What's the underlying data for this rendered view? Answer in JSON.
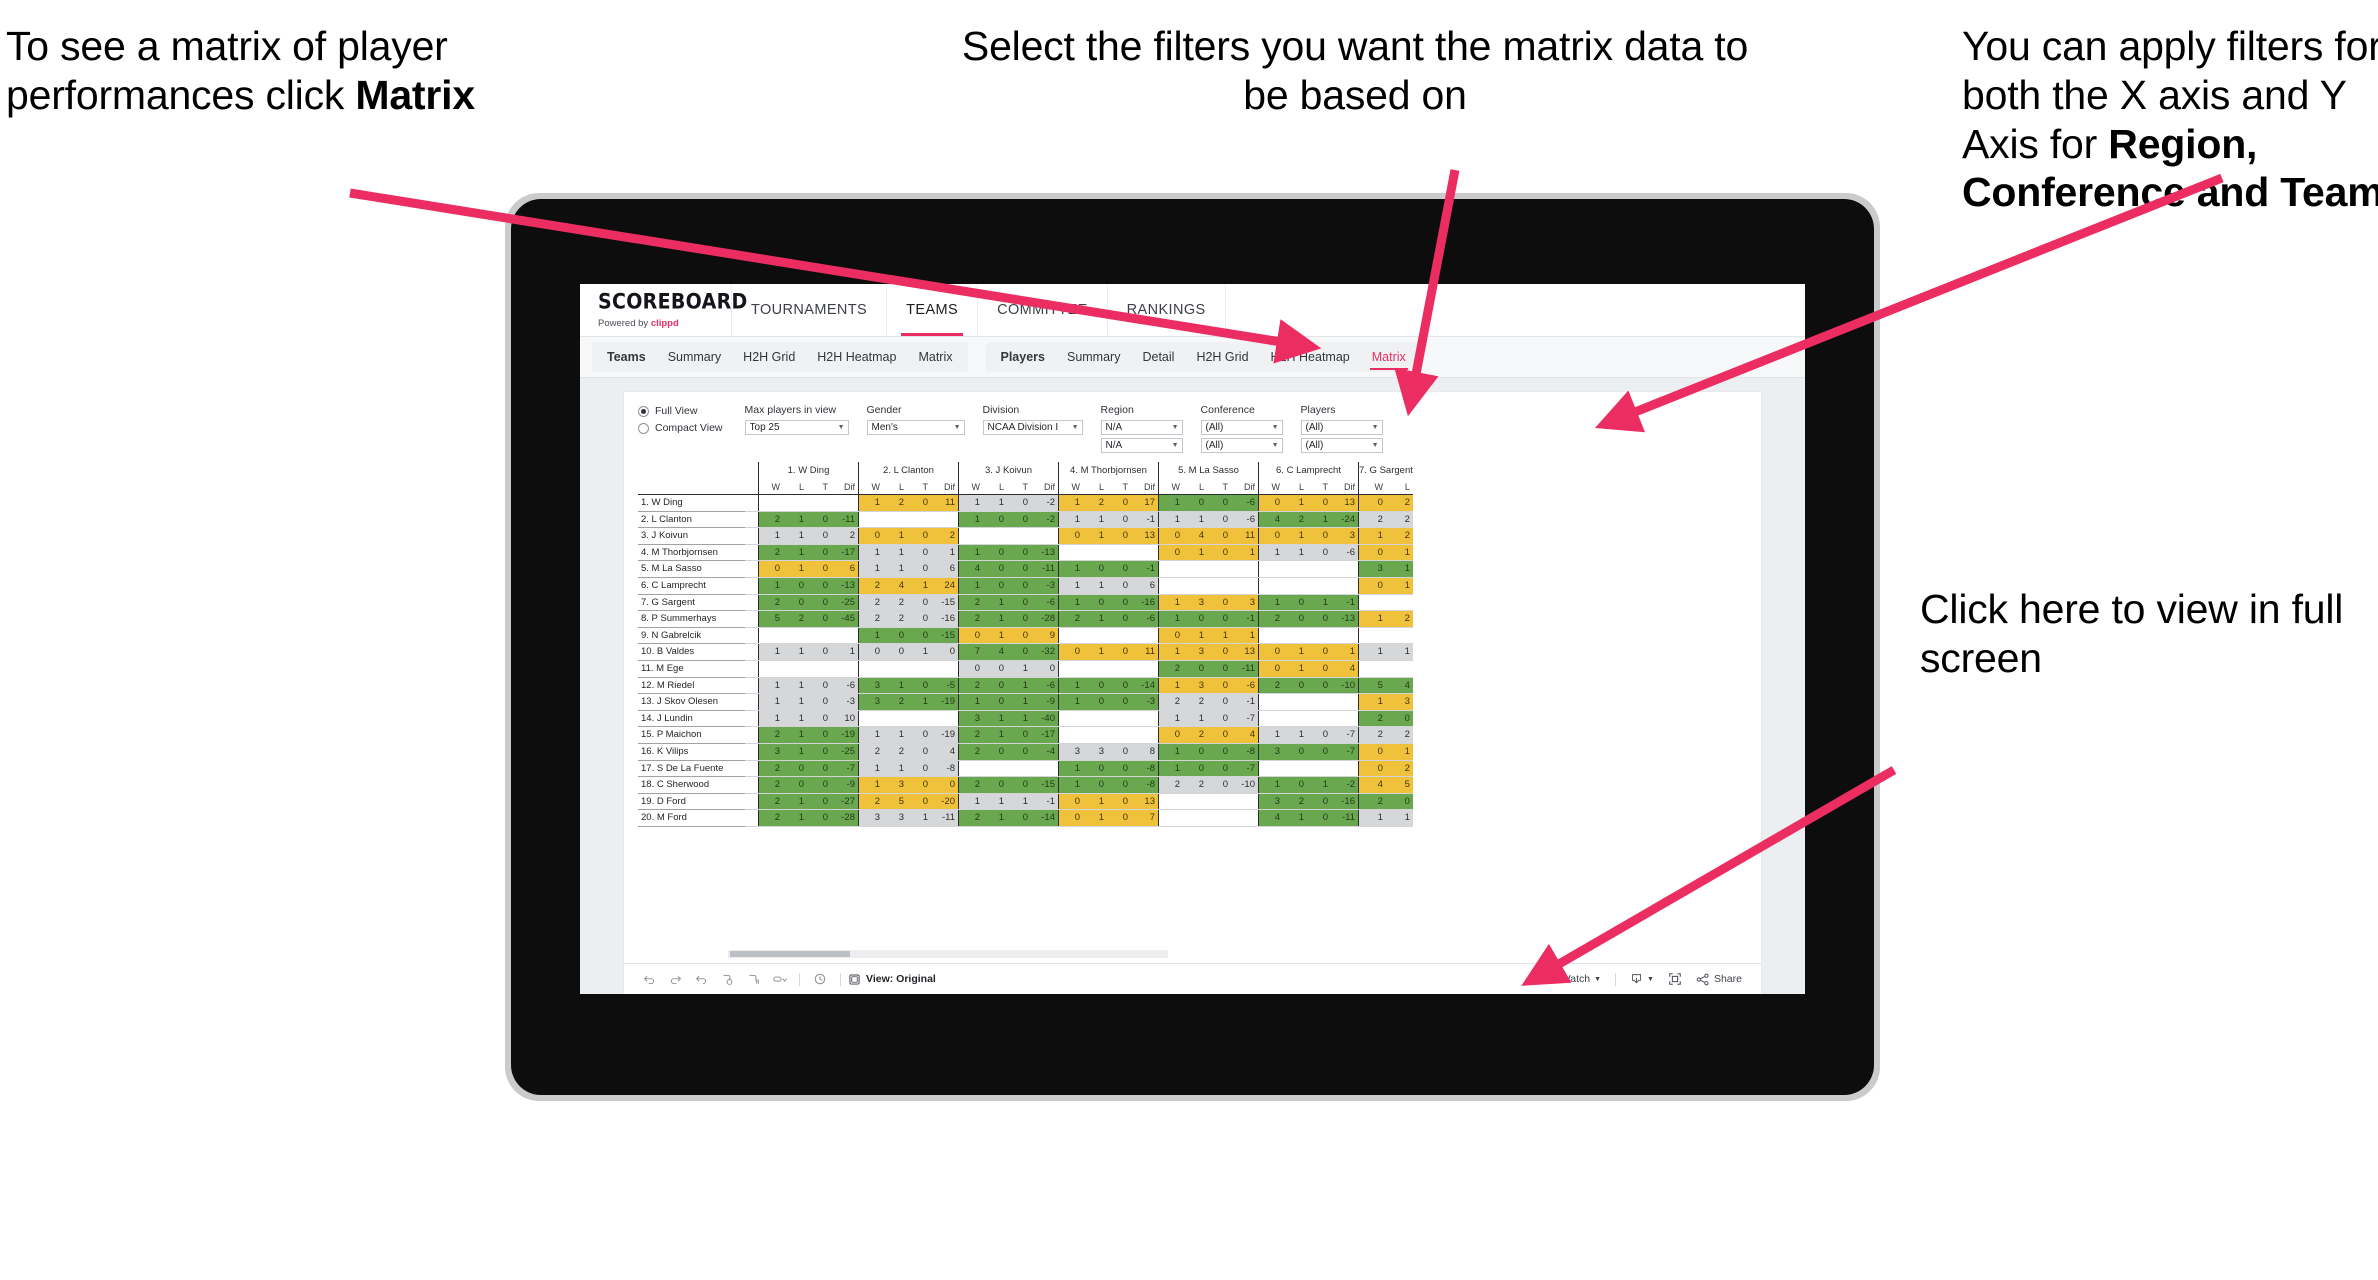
{
  "annotations": {
    "matrix_tip": {
      "pre": "To see a matrix of player performances click ",
      "bold": "Matrix"
    },
    "filters_tip": "Select the filters you want the matrix data to be based on",
    "axis_tip": {
      "pre": "You  can apply filters for both the X axis and Y Axis for ",
      "bold": "Region, Conference and Team"
    },
    "fullscreen_tip": "Click here to view in full screen"
  },
  "app": {
    "brand": {
      "name": "SCOREBOARD",
      "powered_pre": "Powered by ",
      "powered_brand": "clippd"
    },
    "topnav": [
      "TOURNAMENTS",
      "TEAMS",
      "COMMITTEE",
      "RANKINGS"
    ],
    "topnav_active": "TEAMS",
    "subnav_teams": [
      "Teams",
      "Summary",
      "H2H Grid",
      "H2H Heatmap",
      "Matrix"
    ],
    "subnav_players": [
      "Players",
      "Summary",
      "Detail",
      "H2H Grid",
      "H2H Heatmap",
      "Matrix"
    ],
    "subnav_players_active": "Matrix",
    "accent": "#ec2d62"
  },
  "filters": {
    "view_modes": [
      {
        "label": "Full View",
        "selected": true
      },
      {
        "label": "Compact View",
        "selected": false
      }
    ],
    "controls": [
      {
        "label": "Max players in view",
        "values": [
          "Top 25"
        ]
      },
      {
        "label": "Gender",
        "values": [
          "Men's"
        ]
      },
      {
        "label": "Division",
        "values": [
          "NCAA Division I"
        ]
      },
      {
        "label": "Region",
        "values": [
          "N/A",
          "N/A"
        ]
      },
      {
        "label": "Conference",
        "values": [
          "(All)",
          "(All)"
        ]
      },
      {
        "label": "Players",
        "values": [
          "(All)",
          "(All)"
        ]
      }
    ]
  },
  "chart_data": {
    "type": "heatmap",
    "title": "Player head-to-head matrix",
    "sub_columns": [
      "W",
      "L",
      "T",
      "Dif"
    ],
    "columns": [
      "1. W Ding",
      "2. L Clanton",
      "3. J Koivun",
      "4. M Thorbjornsen",
      "5. M La Sasso",
      "6. C Lamprecht",
      "7. G Sargent"
    ],
    "rows": [
      "1. W Ding",
      "2. L Clanton",
      "3. J Koivun",
      "4. M Thorbjornsen",
      "5. M La Sasso",
      "6. C Lamprecht",
      "7. G Sargent",
      "8. P Summerhays",
      "9. N Gabrelcik",
      "10. B Valdes",
      "11. M Ege",
      "12. M Riedel",
      "13. J Skov Olesen",
      "14. J Lundin",
      "15. P Maichon",
      "16. K Vilips",
      "17. S De La Fuente",
      "18. C Sherwood",
      "19. D Ford",
      "20. M Ford"
    ],
    "legend": {
      "green": "favourable",
      "yellow": "unfavourable",
      "grey": "neutral",
      "white": "no data"
    },
    "cells": [
      [
        null,
        [
          "y",
          1,
          2,
          0,
          11
        ],
        [
          "n",
          1,
          1,
          0,
          -2
        ],
        [
          "y",
          1,
          2,
          0,
          17
        ],
        [
          "g",
          1,
          0,
          0,
          -6
        ],
        [
          "y",
          0,
          1,
          0,
          13
        ],
        [
          "y",
          0,
          2
        ]
      ],
      [
        [
          "g",
          2,
          1,
          0,
          -11
        ],
        null,
        [
          "g",
          1,
          0,
          0,
          -2
        ],
        [
          "n",
          1,
          1,
          0,
          -1
        ],
        [
          "n",
          1,
          1,
          0,
          -6
        ],
        [
          "g",
          4,
          2,
          1,
          -24
        ],
        [
          "n",
          2,
          2
        ]
      ],
      [
        [
          "n",
          1,
          1,
          0,
          2
        ],
        [
          "y",
          0,
          1,
          0,
          2
        ],
        null,
        [
          "y",
          0,
          1,
          0,
          13
        ],
        [
          "y",
          0,
          4,
          0,
          11
        ],
        [
          "y",
          0,
          1,
          0,
          3
        ],
        [
          "y",
          1,
          2
        ]
      ],
      [
        [
          "g",
          2,
          1,
          0,
          -17
        ],
        [
          "n",
          1,
          1,
          0,
          1
        ],
        [
          "g",
          1,
          0,
          0,
          -13
        ],
        null,
        [
          "y",
          0,
          1,
          0,
          1
        ],
        [
          "n",
          1,
          1,
          0,
          -6
        ],
        [
          "y",
          0,
          1
        ]
      ],
      [
        [
          "y",
          0,
          1,
          0,
          6
        ],
        [
          "n",
          1,
          1,
          0,
          6
        ],
        [
          "g",
          4,
          0,
          0,
          -11
        ],
        [
          "g",
          1,
          0,
          0,
          -1
        ],
        null,
        null,
        [
          "g",
          3,
          1
        ]
      ],
      [
        [
          "g",
          1,
          0,
          0,
          -13
        ],
        [
          "y",
          2,
          4,
          1,
          24
        ],
        [
          "g",
          1,
          0,
          0,
          -3
        ],
        [
          "n",
          1,
          1,
          0,
          6
        ],
        null,
        null,
        [
          "y",
          0,
          1
        ]
      ],
      [
        [
          "g",
          2,
          0,
          0,
          -25
        ],
        [
          "n",
          2,
          2,
          0,
          -15
        ],
        [
          "g",
          2,
          1,
          0,
          -6
        ],
        [
          "g",
          1,
          0,
          0,
          -16
        ],
        [
          "y",
          1,
          3,
          0,
          3
        ],
        [
          "g",
          1,
          0,
          1,
          -1
        ],
        null
      ],
      [
        [
          "g",
          5,
          2,
          0,
          -45
        ],
        [
          "n",
          2,
          2,
          0,
          -16
        ],
        [
          "g",
          2,
          1,
          0,
          -28
        ],
        [
          "g",
          2,
          1,
          0,
          -6
        ],
        [
          "g",
          1,
          0,
          0,
          -1
        ],
        [
          "g",
          2,
          0,
          0,
          -13
        ],
        [
          "y",
          1,
          2
        ]
      ],
      [
        null,
        [
          "g",
          1,
          0,
          0,
          -15
        ],
        [
          "y",
          0,
          1,
          0,
          9
        ],
        null,
        [
          "y",
          0,
          1,
          1,
          1
        ],
        null,
        null
      ],
      [
        [
          "n",
          1,
          1,
          0,
          1
        ],
        [
          "n",
          0,
          0,
          1,
          0
        ],
        [
          "g",
          7,
          4,
          0,
          -32
        ],
        [
          "y",
          0,
          1,
          0,
          11
        ],
        [
          "y",
          1,
          3,
          0,
          13
        ],
        [
          "y",
          0,
          1,
          0,
          1
        ],
        [
          "n",
          1,
          1
        ]
      ],
      [
        null,
        null,
        [
          "n",
          0,
          0,
          1,
          0
        ],
        null,
        [
          "g",
          2,
          0,
          0,
          -11
        ],
        [
          "y",
          0,
          1,
          0,
          4
        ],
        null
      ],
      [
        [
          "n",
          1,
          1,
          0,
          -6
        ],
        [
          "g",
          3,
          1,
          0,
          -5
        ],
        [
          "g",
          2,
          0,
          1,
          -6
        ],
        [
          "g",
          1,
          0,
          0,
          -14
        ],
        [
          "y",
          1,
          3,
          0,
          -6
        ],
        [
          "g",
          2,
          0,
          0,
          -10
        ],
        [
          "g",
          5,
          4
        ]
      ],
      [
        [
          "n",
          1,
          1,
          0,
          -3
        ],
        [
          "g",
          3,
          2,
          1,
          -19
        ],
        [
          "g",
          1,
          0,
          1,
          -9
        ],
        [
          "g",
          1,
          0,
          0,
          -3
        ],
        [
          "n",
          2,
          2,
          0,
          -1
        ],
        null,
        [
          "y",
          1,
          3
        ]
      ],
      [
        [
          "n",
          1,
          1,
          0,
          10
        ],
        null,
        [
          "g",
          3,
          1,
          1,
          -40
        ],
        null,
        [
          "n",
          1,
          1,
          0,
          -7
        ],
        null,
        [
          "g",
          2,
          0
        ]
      ],
      [
        [
          "g",
          2,
          1,
          0,
          -19
        ],
        [
          "n",
          1,
          1,
          0,
          -19
        ],
        [
          "g",
          2,
          1,
          0,
          -17
        ],
        null,
        [
          "y",
          0,
          2,
          0,
          4
        ],
        [
          "n",
          1,
          1,
          0,
          -7
        ],
        [
          "n",
          2,
          2
        ]
      ],
      [
        [
          "g",
          3,
          1,
          0,
          -25
        ],
        [
          "n",
          2,
          2,
          0,
          4
        ],
        [
          "g",
          2,
          0,
          0,
          -4
        ],
        [
          "n",
          3,
          3,
          0,
          8
        ],
        [
          "g",
          1,
          0,
          0,
          -8
        ],
        [
          "g",
          3,
          0,
          0,
          -7
        ],
        [
          "y",
          0,
          1
        ]
      ],
      [
        [
          "g",
          2,
          0,
          0,
          -7
        ],
        [
          "n",
          1,
          1,
          0,
          -8
        ],
        null,
        [
          "g",
          1,
          0,
          0,
          -8
        ],
        [
          "g",
          1,
          0,
          0,
          -7
        ],
        null,
        [
          "y",
          0,
          2
        ]
      ],
      [
        [
          "g",
          2,
          0,
          0,
          -9
        ],
        [
          "y",
          1,
          3,
          0,
          0
        ],
        [
          "g",
          2,
          0,
          0,
          -15
        ],
        [
          "g",
          1,
          0,
          0,
          -8
        ],
        [
          "n",
          2,
          2,
          0,
          -10
        ],
        [
          "g",
          1,
          0,
          1,
          -2
        ],
        [
          "y",
          4,
          5
        ]
      ],
      [
        [
          "g",
          2,
          1,
          0,
          -27
        ],
        [
          "y",
          2,
          5,
          0,
          -20
        ],
        [
          "n",
          1,
          1,
          1,
          -1
        ],
        [
          "y",
          0,
          1,
          0,
          13
        ],
        null,
        [
          "g",
          3,
          2,
          0,
          -16
        ],
        [
          "g",
          2,
          0
        ]
      ],
      [
        [
          "g",
          2,
          1,
          0,
          -28
        ],
        [
          "n",
          3,
          3,
          1,
          -11
        ],
        [
          "g",
          2,
          1,
          0,
          -14
        ],
        [
          "y",
          0,
          1,
          0,
          7
        ],
        null,
        [
          "g",
          4,
          1,
          0,
          -11
        ],
        [
          "n",
          1,
          1
        ]
      ]
    ]
  },
  "toolbar": {
    "icons": [
      "undo-icon",
      "redo-icon",
      "revert-icon",
      "refresh-icon",
      "pause-icon",
      "alerts-icon"
    ],
    "view_label": "View: Original",
    "watch_label": "Watch",
    "share_label": "Share"
  }
}
